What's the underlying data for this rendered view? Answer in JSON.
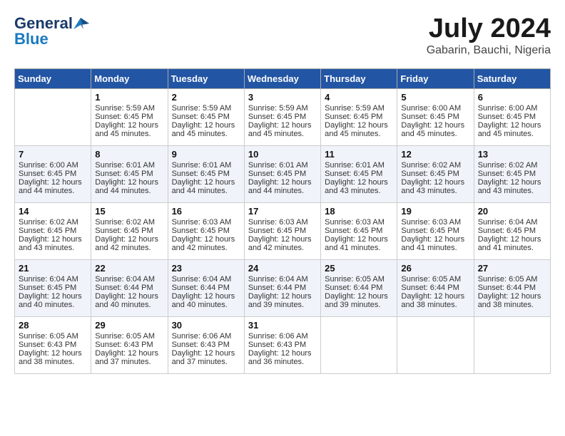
{
  "header": {
    "logo_general": "General",
    "logo_blue": "Blue",
    "month_year": "July 2024",
    "location": "Gabarin, Bauchi, Nigeria"
  },
  "weekdays": [
    "Sunday",
    "Monday",
    "Tuesday",
    "Wednesday",
    "Thursday",
    "Friday",
    "Saturday"
  ],
  "weeks": [
    [
      {
        "day": "",
        "lines": []
      },
      {
        "day": "1",
        "lines": [
          "Sunrise: 5:59 AM",
          "Sunset: 6:45 PM",
          "Daylight: 12 hours",
          "and 45 minutes."
        ]
      },
      {
        "day": "2",
        "lines": [
          "Sunrise: 5:59 AM",
          "Sunset: 6:45 PM",
          "Daylight: 12 hours",
          "and 45 minutes."
        ]
      },
      {
        "day": "3",
        "lines": [
          "Sunrise: 5:59 AM",
          "Sunset: 6:45 PM",
          "Daylight: 12 hours",
          "and 45 minutes."
        ]
      },
      {
        "day": "4",
        "lines": [
          "Sunrise: 5:59 AM",
          "Sunset: 6:45 PM",
          "Daylight: 12 hours",
          "and 45 minutes."
        ]
      },
      {
        "day": "5",
        "lines": [
          "Sunrise: 6:00 AM",
          "Sunset: 6:45 PM",
          "Daylight: 12 hours",
          "and 45 minutes."
        ]
      },
      {
        "day": "6",
        "lines": [
          "Sunrise: 6:00 AM",
          "Sunset: 6:45 PM",
          "Daylight: 12 hours",
          "and 45 minutes."
        ]
      }
    ],
    [
      {
        "day": "7",
        "lines": [
          "Sunrise: 6:00 AM",
          "Sunset: 6:45 PM",
          "Daylight: 12 hours",
          "and 44 minutes."
        ]
      },
      {
        "day": "8",
        "lines": [
          "Sunrise: 6:01 AM",
          "Sunset: 6:45 PM",
          "Daylight: 12 hours",
          "and 44 minutes."
        ]
      },
      {
        "day": "9",
        "lines": [
          "Sunrise: 6:01 AM",
          "Sunset: 6:45 PM",
          "Daylight: 12 hours",
          "and 44 minutes."
        ]
      },
      {
        "day": "10",
        "lines": [
          "Sunrise: 6:01 AM",
          "Sunset: 6:45 PM",
          "Daylight: 12 hours",
          "and 44 minutes."
        ]
      },
      {
        "day": "11",
        "lines": [
          "Sunrise: 6:01 AM",
          "Sunset: 6:45 PM",
          "Daylight: 12 hours",
          "and 43 minutes."
        ]
      },
      {
        "day": "12",
        "lines": [
          "Sunrise: 6:02 AM",
          "Sunset: 6:45 PM",
          "Daylight: 12 hours",
          "and 43 minutes."
        ]
      },
      {
        "day": "13",
        "lines": [
          "Sunrise: 6:02 AM",
          "Sunset: 6:45 PM",
          "Daylight: 12 hours",
          "and 43 minutes."
        ]
      }
    ],
    [
      {
        "day": "14",
        "lines": [
          "Sunrise: 6:02 AM",
          "Sunset: 6:45 PM",
          "Daylight: 12 hours",
          "and 43 minutes."
        ]
      },
      {
        "day": "15",
        "lines": [
          "Sunrise: 6:02 AM",
          "Sunset: 6:45 PM",
          "Daylight: 12 hours",
          "and 42 minutes."
        ]
      },
      {
        "day": "16",
        "lines": [
          "Sunrise: 6:03 AM",
          "Sunset: 6:45 PM",
          "Daylight: 12 hours",
          "and 42 minutes."
        ]
      },
      {
        "day": "17",
        "lines": [
          "Sunrise: 6:03 AM",
          "Sunset: 6:45 PM",
          "Daylight: 12 hours",
          "and 42 minutes."
        ]
      },
      {
        "day": "18",
        "lines": [
          "Sunrise: 6:03 AM",
          "Sunset: 6:45 PM",
          "Daylight: 12 hours",
          "and 41 minutes."
        ]
      },
      {
        "day": "19",
        "lines": [
          "Sunrise: 6:03 AM",
          "Sunset: 6:45 PM",
          "Daylight: 12 hours",
          "and 41 minutes."
        ]
      },
      {
        "day": "20",
        "lines": [
          "Sunrise: 6:04 AM",
          "Sunset: 6:45 PM",
          "Daylight: 12 hours",
          "and 41 minutes."
        ]
      }
    ],
    [
      {
        "day": "21",
        "lines": [
          "Sunrise: 6:04 AM",
          "Sunset: 6:45 PM",
          "Daylight: 12 hours",
          "and 40 minutes."
        ]
      },
      {
        "day": "22",
        "lines": [
          "Sunrise: 6:04 AM",
          "Sunset: 6:44 PM",
          "Daylight: 12 hours",
          "and 40 minutes."
        ]
      },
      {
        "day": "23",
        "lines": [
          "Sunrise: 6:04 AM",
          "Sunset: 6:44 PM",
          "Daylight: 12 hours",
          "and 40 minutes."
        ]
      },
      {
        "day": "24",
        "lines": [
          "Sunrise: 6:04 AM",
          "Sunset: 6:44 PM",
          "Daylight: 12 hours",
          "and 39 minutes."
        ]
      },
      {
        "day": "25",
        "lines": [
          "Sunrise: 6:05 AM",
          "Sunset: 6:44 PM",
          "Daylight: 12 hours",
          "and 39 minutes."
        ]
      },
      {
        "day": "26",
        "lines": [
          "Sunrise: 6:05 AM",
          "Sunset: 6:44 PM",
          "Daylight: 12 hours",
          "and 38 minutes."
        ]
      },
      {
        "day": "27",
        "lines": [
          "Sunrise: 6:05 AM",
          "Sunset: 6:44 PM",
          "Daylight: 12 hours",
          "and 38 minutes."
        ]
      }
    ],
    [
      {
        "day": "28",
        "lines": [
          "Sunrise: 6:05 AM",
          "Sunset: 6:43 PM",
          "Daylight: 12 hours",
          "and 38 minutes."
        ]
      },
      {
        "day": "29",
        "lines": [
          "Sunrise: 6:05 AM",
          "Sunset: 6:43 PM",
          "Daylight: 12 hours",
          "and 37 minutes."
        ]
      },
      {
        "day": "30",
        "lines": [
          "Sunrise: 6:06 AM",
          "Sunset: 6:43 PM",
          "Daylight: 12 hours",
          "and 37 minutes."
        ]
      },
      {
        "day": "31",
        "lines": [
          "Sunrise: 6:06 AM",
          "Sunset: 6:43 PM",
          "Daylight: 12 hours",
          "and 36 minutes."
        ]
      },
      {
        "day": "",
        "lines": []
      },
      {
        "day": "",
        "lines": []
      },
      {
        "day": "",
        "lines": []
      }
    ]
  ]
}
